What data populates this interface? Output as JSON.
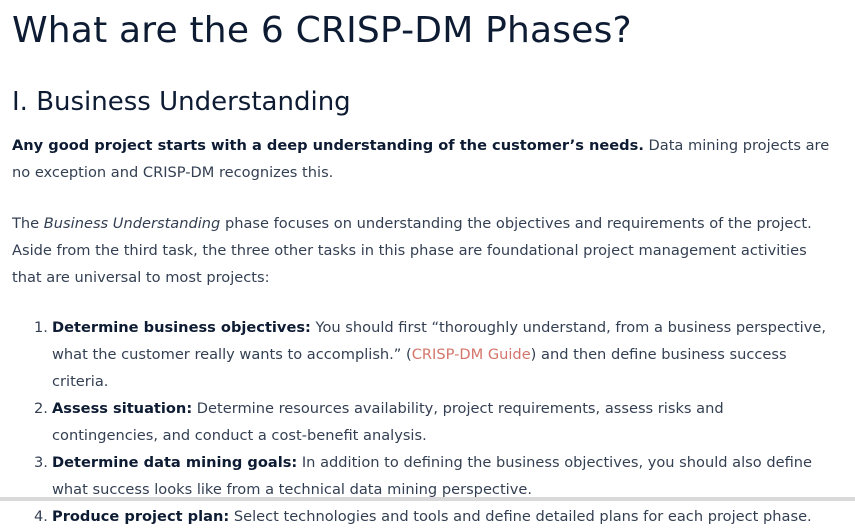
{
  "title": "What are the 6 CRISP-DM Phases?",
  "section": {
    "heading": "I. Business Understanding",
    "intro_bold": "Any good project starts with a deep understanding of the customer’s needs.",
    "intro_rest": " Data mining projects are no exception and CRISP-DM recognizes this.",
    "p2_before": "The ",
    "p2_italic": "Business Understanding",
    "p2_after": " phase focuses on understanding the objectives and requirements of the project. Aside from the third task, the three other tasks in this phase are foundational project management activities that are universal to most projects:",
    "items": [
      {
        "num": "1.",
        "bold": "Determine business objectives:",
        "text_before": " You should first “thoroughly understand, from a business perspective, what the customer really wants to accomplish.” (",
        "link": "CRISP-DM Guide",
        "text_after": ") and then define business success criteria."
      },
      {
        "num": "2.",
        "bold": "Assess situation:",
        "text": " Determine resources availability, project requirements, assess risks and contingencies, and conduct a cost-benefit analysis."
      },
      {
        "num": "3.",
        "bold": "Determine data mining goals:",
        "text": " In addition to defining the business objectives, you should also define what success looks like from a technical data mining perspective."
      },
      {
        "num": "4.",
        "bold": "Produce project plan:",
        "text": " Select technologies and tools and define detailed plans for each project phase."
      }
    ]
  },
  "colors": {
    "heading": "#0d1b33",
    "body": "#333f52",
    "link": "#d4756b"
  }
}
